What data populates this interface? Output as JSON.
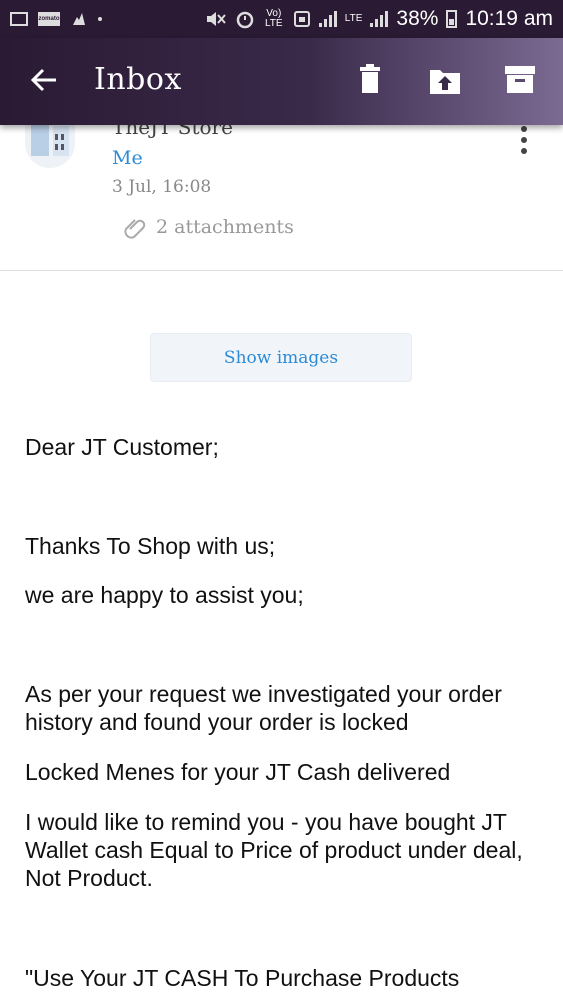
{
  "status_bar": {
    "network_label": "LTE",
    "volte_label": "Vo) LTE",
    "battery": "38%",
    "time": "10:19 am",
    "notification_icons": [
      "image-icon",
      "zomato-icon",
      "pointer-icon",
      "dot-icon"
    ]
  },
  "app_bar": {
    "title": "Inbox",
    "actions": [
      "delete-icon",
      "move-to-folder-icon",
      "archive-icon"
    ]
  },
  "email": {
    "sender": "TheJT Store",
    "recipient": "Me",
    "date": "3 Jul, 16:08",
    "attachments_label": "2 attachments",
    "show_images_label": "Show images",
    "body": [
      "Dear JT Customer;",
      "Thanks To Shop with us;",
      "we are happy to assist you;",
      "As per your request we investigated your order history and found your order is locked",
      "Locked Menes for your JT Cash delivered",
      "I would like to remind you - you have bought JT Wallet cash Equal to Price of product under deal, Not Product.",
      "\"Use Your JT CASH To Purchase Products"
    ]
  },
  "colors": {
    "app_bar_start": "#2a1a33",
    "app_bar_end": "#7b6a92",
    "link_blue": "#2b8bd6"
  }
}
